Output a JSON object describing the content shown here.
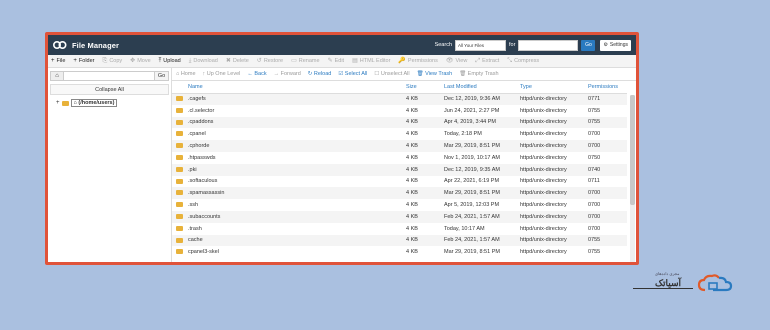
{
  "header": {
    "title": "File Manager",
    "search_label": "Search",
    "search_scope": "All Your Files",
    "for_label": "for",
    "go_label": "Go",
    "settings_label": "Settings"
  },
  "toolbar": [
    {
      "label": "File",
      "icon": "+",
      "enabled": true,
      "name": "new-file-button"
    },
    {
      "label": "Folder",
      "icon": "+",
      "enabled": true,
      "name": "new-folder-button"
    },
    {
      "label": "Copy",
      "icon": "⎘",
      "enabled": false,
      "name": "copy-button"
    },
    {
      "label": "Move",
      "icon": "✥",
      "enabled": false,
      "name": "move-button"
    },
    {
      "label": "Upload",
      "icon": "⤒",
      "enabled": true,
      "name": "upload-button"
    },
    {
      "label": "Download",
      "icon": "⤓",
      "enabled": false,
      "name": "download-button"
    },
    {
      "label": "Delete",
      "icon": "✖",
      "enabled": false,
      "name": "delete-button"
    },
    {
      "label": "Restore",
      "icon": "↺",
      "enabled": false,
      "name": "restore-button"
    },
    {
      "label": "Rename",
      "icon": "▭",
      "enabled": false,
      "name": "rename-button"
    },
    {
      "label": "Edit",
      "icon": "✎",
      "enabled": false,
      "name": "edit-button"
    },
    {
      "label": "HTML Editor",
      "icon": "▤",
      "enabled": false,
      "name": "html-editor-button"
    },
    {
      "label": "Permissions",
      "icon": "🔑",
      "enabled": false,
      "name": "permissions-button"
    },
    {
      "label": "View",
      "icon": "👁",
      "enabled": false,
      "name": "view-button"
    },
    {
      "label": "Extract",
      "icon": "⤢",
      "enabled": false,
      "name": "extract-button"
    },
    {
      "label": "Compress",
      "icon": "⤡",
      "enabled": false,
      "name": "compress-button"
    }
  ],
  "sidebar": {
    "go_label": "Go",
    "collapse_all": "Collapse All",
    "tree_root": "(/home/users)"
  },
  "nav": [
    {
      "label": "Home",
      "icon": "⌂",
      "enabled": false,
      "name": "nav-home"
    },
    {
      "label": "Up One Level",
      "icon": "↑",
      "enabled": false,
      "name": "nav-up"
    },
    {
      "label": "Back",
      "icon": "←",
      "enabled": true,
      "name": "nav-back"
    },
    {
      "label": "Forward",
      "icon": "→",
      "enabled": false,
      "name": "nav-forward"
    },
    {
      "label": "Reload",
      "icon": "↻",
      "enabled": true,
      "name": "nav-reload"
    },
    {
      "label": "Select All",
      "icon": "☑",
      "enabled": true,
      "name": "nav-select-all"
    },
    {
      "label": "Unselect All",
      "icon": "☐",
      "enabled": false,
      "name": "nav-unselect-all"
    },
    {
      "label": "View Trash",
      "icon": "🗑",
      "enabled": true,
      "name": "nav-view-trash"
    },
    {
      "label": "Empty Trash",
      "icon": "🗑",
      "enabled": false,
      "name": "nav-empty-trash"
    }
  ],
  "columns": [
    "Name",
    "Size",
    "Last Modified",
    "Type",
    "Permissions"
  ],
  "files": [
    {
      "name": ".cagefs",
      "size": "4 KB",
      "modified": "Dec 12, 2019, 9:36 AM",
      "type": "httpd/unix-directory",
      "perm": "0771"
    },
    {
      "name": ".cl.selector",
      "size": "4 KB",
      "modified": "Jun 24, 2021, 2:27 PM",
      "type": "httpd/unix-directory",
      "perm": "0755"
    },
    {
      "name": ".cpaddons",
      "size": "4 KB",
      "modified": "Apr 4, 2019, 3:44 PM",
      "type": "httpd/unix-directory",
      "perm": "0755"
    },
    {
      "name": ".cpanel",
      "size": "4 KB",
      "modified": "Today, 2:18 PM",
      "type": "httpd/unix-directory",
      "perm": "0700"
    },
    {
      "name": ".cphorde",
      "size": "4 KB",
      "modified": "Mar 29, 2019, 8:51 PM",
      "type": "httpd/unix-directory",
      "perm": "0700"
    },
    {
      "name": ".htpasswds",
      "size": "4 KB",
      "modified": "Nov 1, 2019, 10:17 AM",
      "type": "httpd/unix-directory",
      "perm": "0750"
    },
    {
      "name": ".pki",
      "size": "4 KB",
      "modified": "Dec 12, 2019, 9:35 AM",
      "type": "httpd/unix-directory",
      "perm": "0740"
    },
    {
      "name": ".softaculous",
      "size": "4 KB",
      "modified": "Apr 22, 2021, 6:19 PM",
      "type": "httpd/unix-directory",
      "perm": "0711"
    },
    {
      "name": ".spamassassin",
      "size": "4 KB",
      "modified": "Mar 29, 2019, 8:51 PM",
      "type": "httpd/unix-directory",
      "perm": "0700"
    },
    {
      "name": ".ssh",
      "size": "4 KB",
      "modified": "Apr 5, 2019, 12:03 PM",
      "type": "httpd/unix-directory",
      "perm": "0700"
    },
    {
      "name": ".subaccounts",
      "size": "4 KB",
      "modified": "Feb 24, 2021, 1:57 AM",
      "type": "httpd/unix-directory",
      "perm": "0700"
    },
    {
      "name": ".trash",
      "size": "4 KB",
      "modified": "Today, 10:17 AM",
      "type": "httpd/unix-directory",
      "perm": "0700"
    },
    {
      "name": "cache",
      "size": "4 KB",
      "modified": "Feb 24, 2021, 1:57 AM",
      "type": "httpd/unix-directory",
      "perm": "0755"
    },
    {
      "name": "cpanel3-skel",
      "size": "4 KB",
      "modified": "Mar 29, 2019, 8:51 PM",
      "type": "httpd/unix-directory",
      "perm": "0755"
    }
  ],
  "brand": {
    "name": "آسیاتک",
    "tagline": "مجری داده‌های"
  },
  "colors": {
    "frame_border": "#e0533a",
    "header_bg": "#2c3e50",
    "link": "#2a7ac0",
    "folder": "#e8b23a",
    "background": "#aac0e0"
  }
}
